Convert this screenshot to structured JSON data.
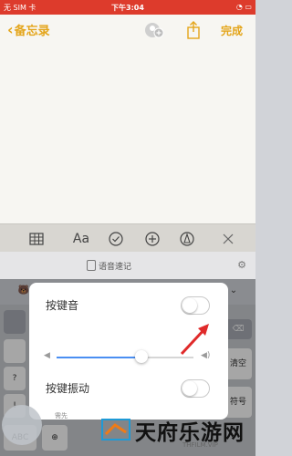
{
  "status": {
    "carrier": "无 SIM 卡",
    "time": "下午3:04",
    "battery": "⏚ ▭"
  },
  "nav": {
    "back_label": "备忘录",
    "done_label": "完成"
  },
  "toolbar": {
    "text_style_label": "Aa"
  },
  "voice": {
    "label": "语音速记"
  },
  "popup": {
    "key_sound_label": "按键音",
    "key_vibration_label": "按键振动",
    "volume_level": 0.62,
    "hint": "需先"
  },
  "keyboard": {
    "abc_label": "ABC",
    "empty_label": "清空",
    "symbol_label": "符号",
    "question": "?",
    "exclaim": "!"
  },
  "watermark": {
    "title": "天府乐游网",
    "sub": "THFILM.VIP"
  },
  "colors": {
    "accent": "#e4a51a",
    "status_bar": "#dd3b2c",
    "slider": "#4a8ff2",
    "arrow": "#e02a2a"
  }
}
